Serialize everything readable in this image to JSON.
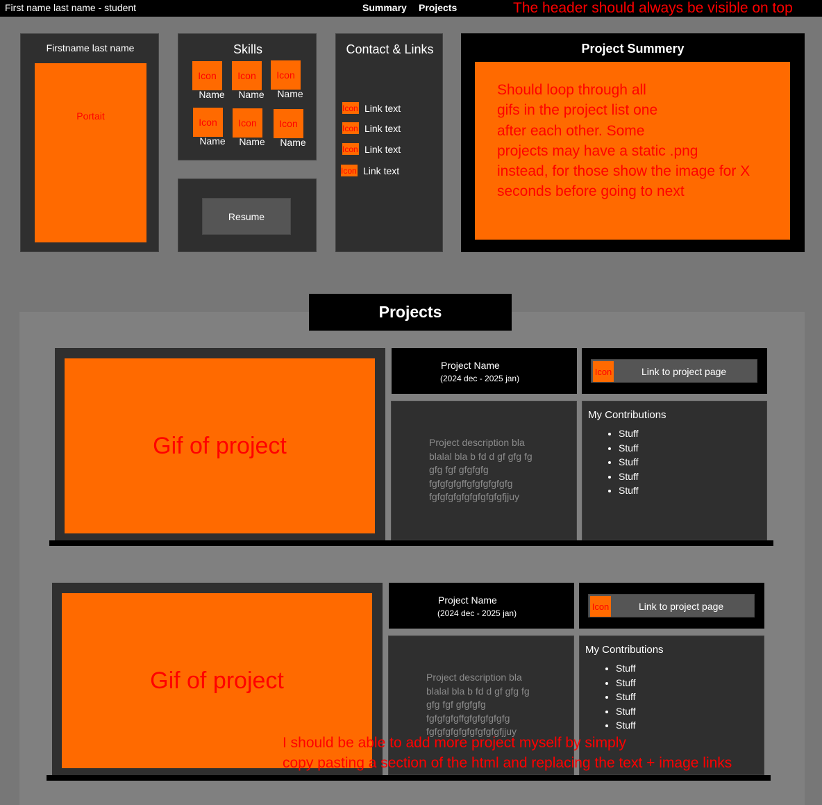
{
  "header": {
    "title": "First name last name - student",
    "nav": [
      "Summary",
      "Projects"
    ],
    "note": "The header should always be visible on top"
  },
  "profile": {
    "name": "Firstname last name",
    "portrait": "Portait"
  },
  "skills": {
    "title": "Skills",
    "items": [
      {
        "icon": "Icon",
        "name": "Name"
      },
      {
        "icon": "Icon",
        "name": "Name"
      },
      {
        "icon": "Icon",
        "name": "Name"
      },
      {
        "icon": "Icon",
        "name": "Name"
      },
      {
        "icon": "Icon",
        "name": "Name"
      },
      {
        "icon": "Icon",
        "name": "Name"
      }
    ]
  },
  "resume": {
    "label": "Resume"
  },
  "contact": {
    "title": "Contact & Links",
    "links": [
      {
        "icon": "Icon",
        "text": "Link text"
      },
      {
        "icon": "Icon",
        "text": "Link text"
      },
      {
        "icon": "Icon",
        "text": "Link text"
      },
      {
        "icon": "Icon",
        "text": "Link text"
      }
    ]
  },
  "summary": {
    "title": "Project Summery",
    "lines": [
      "Should loop through all",
      "gifs in the project list one",
      "after each other. Some",
      "projects may have a static .png",
      "instead, for those show the image for X",
      "seconds before going to next"
    ]
  },
  "projects_section": {
    "title": "Projects",
    "note": [
      "I should be able to add more project myself by simply",
      "copy pasting a section of the html and replacing the  text + image links"
    ]
  },
  "projects": [
    {
      "gif": "Gif of project",
      "name": "Project Name",
      "dates": "(2024 dec - 2025 jan)",
      "link_icon": "Icon",
      "link": "Link to project page",
      "description": [
        "Project description bla",
        "blalal bla b fd d gf gfg fg",
        "gfg fgf gfgfgfg",
        "fgfgfgfgffgfgfgfgfgfg",
        "fgfgfgfgfgfgfgfgfgfjjuy"
      ],
      "contrib_title": "My Contributions",
      "contributions": [
        "Stuff",
        "Stuff",
        "Stuff",
        "Stuff",
        "Stuff"
      ]
    },
    {
      "gif": "Gif of project",
      "name": "Project Name",
      "dates": "(2024 dec - 2025 jan)",
      "link_icon": "Icon",
      "link": "Link to project page",
      "description": [
        "Project description bla",
        "blalal bla b fd d gf gfg fg",
        "gfg fgf gfgfgfg",
        "fgfgfgfgffgfgfgfgfgfg",
        "fgfgfgfgfgfgfgfgfgfjjuy"
      ],
      "contrib_title": "My Contributions",
      "contributions": [
        "Stuff",
        "Stuff",
        "Stuff",
        "Stuff",
        "Stuff"
      ]
    }
  ],
  "colors": {
    "accent": "#ff6a00",
    "annotation": "#ff0000",
    "card": "#2f2f2f",
    "page": "#777777"
  }
}
